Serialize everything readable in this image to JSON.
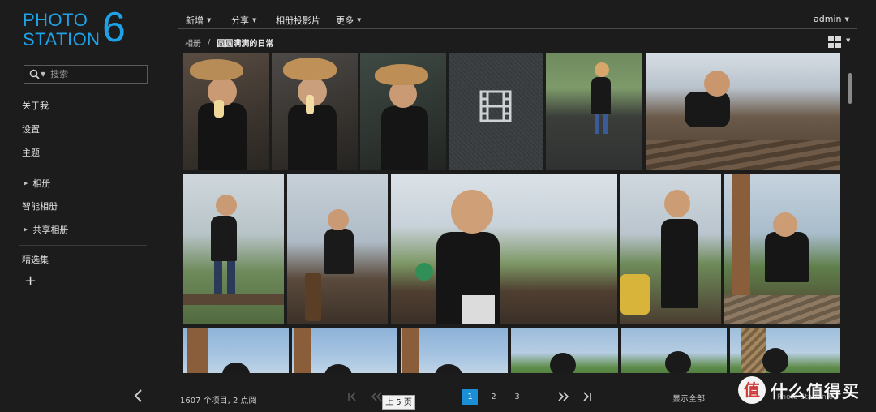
{
  "logo": {
    "line1": "PHOTO",
    "line2": "STATION",
    "version": "6"
  },
  "search": {
    "placeholder": "搜索"
  },
  "sidebar": {
    "items": [
      {
        "label": "关于我"
      },
      {
        "label": "设置"
      },
      {
        "label": "主题"
      }
    ],
    "albums_label": "相册",
    "smart_albums_label": "智能相册",
    "shared_albums_label": "共享相册",
    "featured_label": "精选集"
  },
  "toolbar": {
    "new_label": "新增",
    "share_label": "分享",
    "slideshow_label": "相册投影片",
    "more_label": "更多",
    "user_label": "admin"
  },
  "breadcrumb": {
    "root": "相册",
    "separator": "/",
    "current": "圆圆满满的日常"
  },
  "footer": {
    "count_text": "1607 个项目, 2 点阅",
    "pages": [
      "1",
      "2",
      "3"
    ],
    "active_page": "1",
    "tooltip": "上 5 页",
    "show_all_label": "显示全部",
    "brand_text": "Photo Station 6",
    "watermark_text": "什么值得买"
  },
  "colors": {
    "accent": "#1ea1e6",
    "page_active": "#1a8fd6",
    "background": "#1c1c1c"
  },
  "icons": [
    "search-icon",
    "video-icon",
    "grid-view-icon",
    "back-arrow-icon",
    "first-page-icon",
    "prev-page-icon",
    "next-5-pages-icon",
    "last-page-icon",
    "plus-icon"
  ]
}
